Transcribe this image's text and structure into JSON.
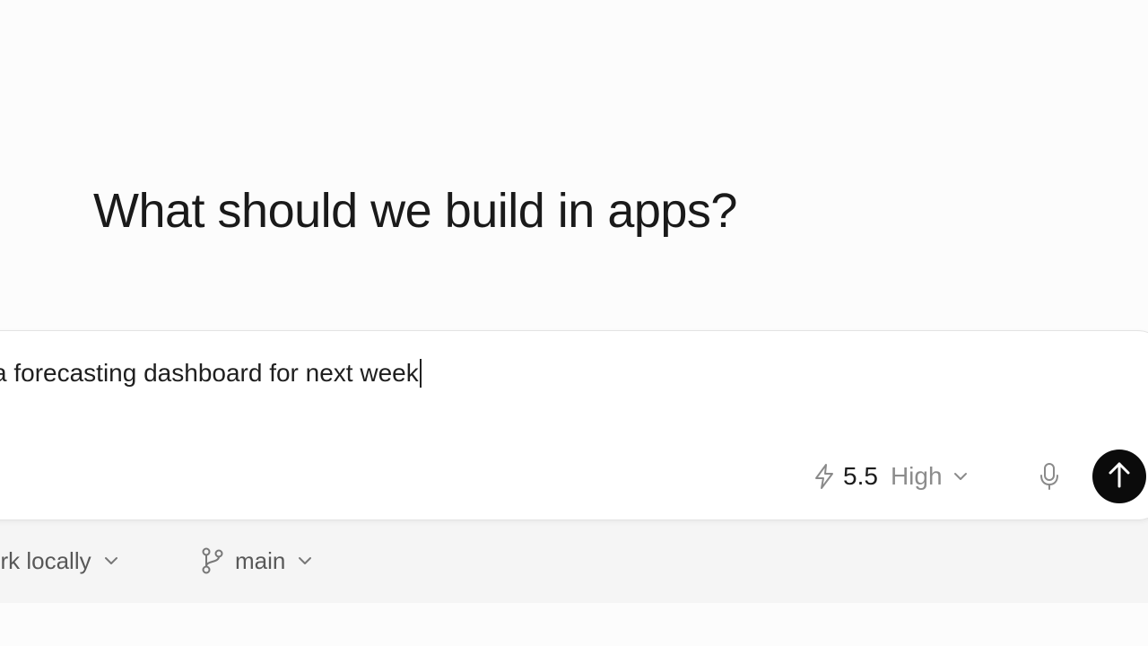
{
  "heading": "What should we build in apps?",
  "composer": {
    "prompt_text": "a forecasting dashboard for next week",
    "model": {
      "version": "5.5",
      "effort": "High",
      "icon": "bolt-icon"
    },
    "mic_icon": "microphone-icon",
    "send_icon": "arrow-up-icon"
  },
  "footer": {
    "run_location": "ork locally",
    "branch": "main",
    "branch_icon": "git-branch-icon"
  },
  "colors": {
    "send_button": "#0b0b0b",
    "background": "#fcfcfc",
    "muted_text": "#8c8c8c"
  }
}
